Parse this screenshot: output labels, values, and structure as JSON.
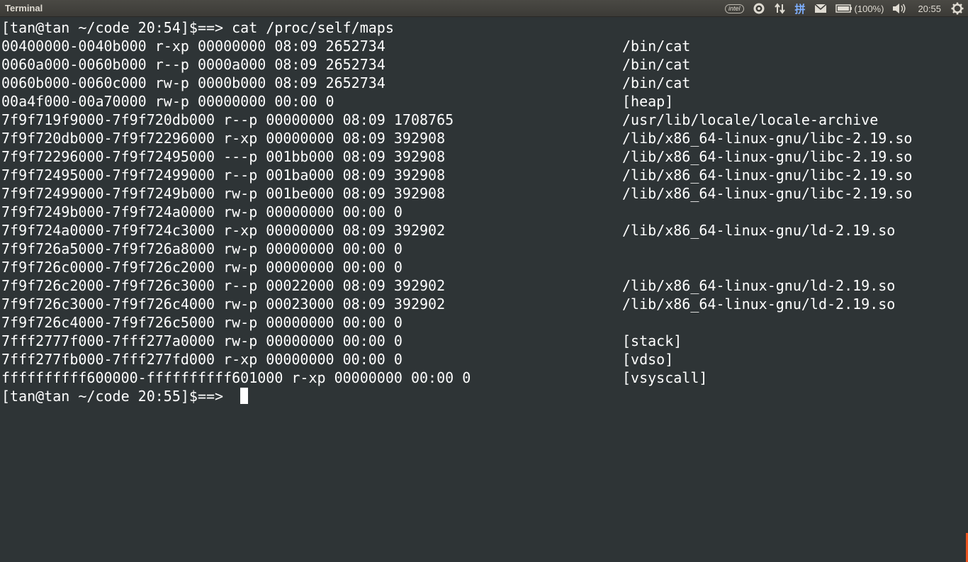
{
  "topbar": {
    "app_title": "Terminal",
    "intel_label": "intel",
    "battery_text": "(100%)",
    "clock": "20:55",
    "ime_glyph": "拼",
    "icons": [
      "intel-icon",
      "sync-icon",
      "network-icon",
      "input-method-icon",
      "mail-icon",
      "battery-icon",
      "volume-icon",
      "gear-icon"
    ]
  },
  "terminal": {
    "command_line": "[tan@tan ~/code 20:54]$==> cat /proc/self/maps",
    "rows": [
      {
        "mapping": "00400000-0040b000 r-xp 00000000 08:09 2652734",
        "path": "/bin/cat"
      },
      {
        "mapping": "0060a000-0060b000 r--p 0000a000 08:09 2652734",
        "path": "/bin/cat"
      },
      {
        "mapping": "0060b000-0060c000 rw-p 0000b000 08:09 2652734",
        "path": "/bin/cat"
      },
      {
        "mapping": "00a4f000-00a70000 rw-p 00000000 00:00 0",
        "path": "[heap]"
      },
      {
        "mapping": "7f9f719f9000-7f9f720db000 r--p 00000000 08:09 1708765",
        "path": "/usr/lib/locale/locale-archive"
      },
      {
        "mapping": "7f9f720db000-7f9f72296000 r-xp 00000000 08:09 392908",
        "path": "/lib/x86_64-linux-gnu/libc-2.19.so"
      },
      {
        "mapping": "7f9f72296000-7f9f72495000 ---p 001bb000 08:09 392908",
        "path": "/lib/x86_64-linux-gnu/libc-2.19.so"
      },
      {
        "mapping": "7f9f72495000-7f9f72499000 r--p 001ba000 08:09 392908",
        "path": "/lib/x86_64-linux-gnu/libc-2.19.so"
      },
      {
        "mapping": "7f9f72499000-7f9f7249b000 rw-p 001be000 08:09 392908",
        "path": "/lib/x86_64-linux-gnu/libc-2.19.so"
      },
      {
        "mapping": "7f9f7249b000-7f9f724a0000 rw-p 00000000 00:00 0",
        "path": ""
      },
      {
        "mapping": "7f9f724a0000-7f9f724c3000 r-xp 00000000 08:09 392902",
        "path": "/lib/x86_64-linux-gnu/ld-2.19.so"
      },
      {
        "mapping": "7f9f726a5000-7f9f726a8000 rw-p 00000000 00:00 0",
        "path": ""
      },
      {
        "mapping": "7f9f726c0000-7f9f726c2000 rw-p 00000000 00:00 0",
        "path": ""
      },
      {
        "mapping": "7f9f726c2000-7f9f726c3000 r--p 00022000 08:09 392902",
        "path": "/lib/x86_64-linux-gnu/ld-2.19.so"
      },
      {
        "mapping": "7f9f726c3000-7f9f726c4000 rw-p 00023000 08:09 392902",
        "path": "/lib/x86_64-linux-gnu/ld-2.19.so"
      },
      {
        "mapping": "7f9f726c4000-7f9f726c5000 rw-p 00000000 00:00 0",
        "path": ""
      },
      {
        "mapping": "7fff2777f000-7fff277a0000 rw-p 00000000 00:00 0",
        "path": "[stack]"
      },
      {
        "mapping": "7fff277fb000-7fff277fd000 r-xp 00000000 00:00 0",
        "path": "[vdso]"
      },
      {
        "mapping": "ffffffffff600000-ffffffffff601000 r-xp 00000000 00:00 0",
        "path": "[vsyscall]"
      }
    ],
    "prompt_line": "[tan@tan ~/code 20:55]$==> "
  }
}
